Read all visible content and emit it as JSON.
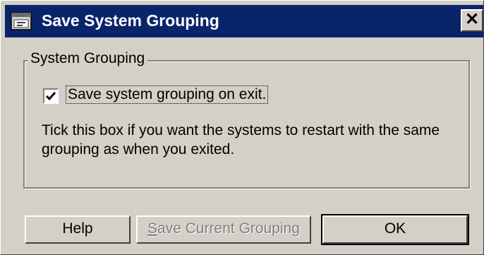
{
  "window": {
    "title": "Save System Grouping",
    "close_glyph": "✕",
    "app_icon": "window-app-icon"
  },
  "group": {
    "legend": "System Grouping",
    "checkbox": {
      "label": "Save system grouping on exit.",
      "checked": true
    },
    "help_text": "Tick this box if you want the systems to restart with the same grouping as when you exited."
  },
  "buttons": {
    "help": "Help",
    "save_current_prefix": "S",
    "save_current_rest": "ave Current Grouping",
    "ok": "OK"
  },
  "colors": {
    "titlebar": "#0a246a",
    "face": "#d4d0c8",
    "disabled_text": "#808080"
  }
}
